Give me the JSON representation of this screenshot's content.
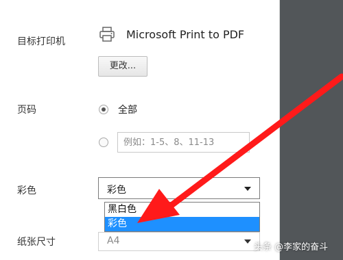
{
  "destination": {
    "label": "目标打印机",
    "printer_name": "Microsoft Print to PDF",
    "change_button": "更改...",
    "icon": "printer-icon"
  },
  "pages": {
    "label": "页码",
    "options": [
      {
        "label": "全部",
        "selected": true
      },
      {
        "placeholder": "例如：1-5、8、11-13",
        "selected": false
      }
    ]
  },
  "color": {
    "label": "彩色",
    "selected": "彩色",
    "dropdown_options": [
      "黑白色",
      "彩色"
    ],
    "highlighted_option": "彩色",
    "highlight_color": "#1e90ff"
  },
  "paper_size": {
    "label": "纸张尺寸",
    "value": "A4"
  },
  "annotation": {
    "arrow_color": "#ff1a1a",
    "watermark": "头条 @李家的奋斗"
  }
}
